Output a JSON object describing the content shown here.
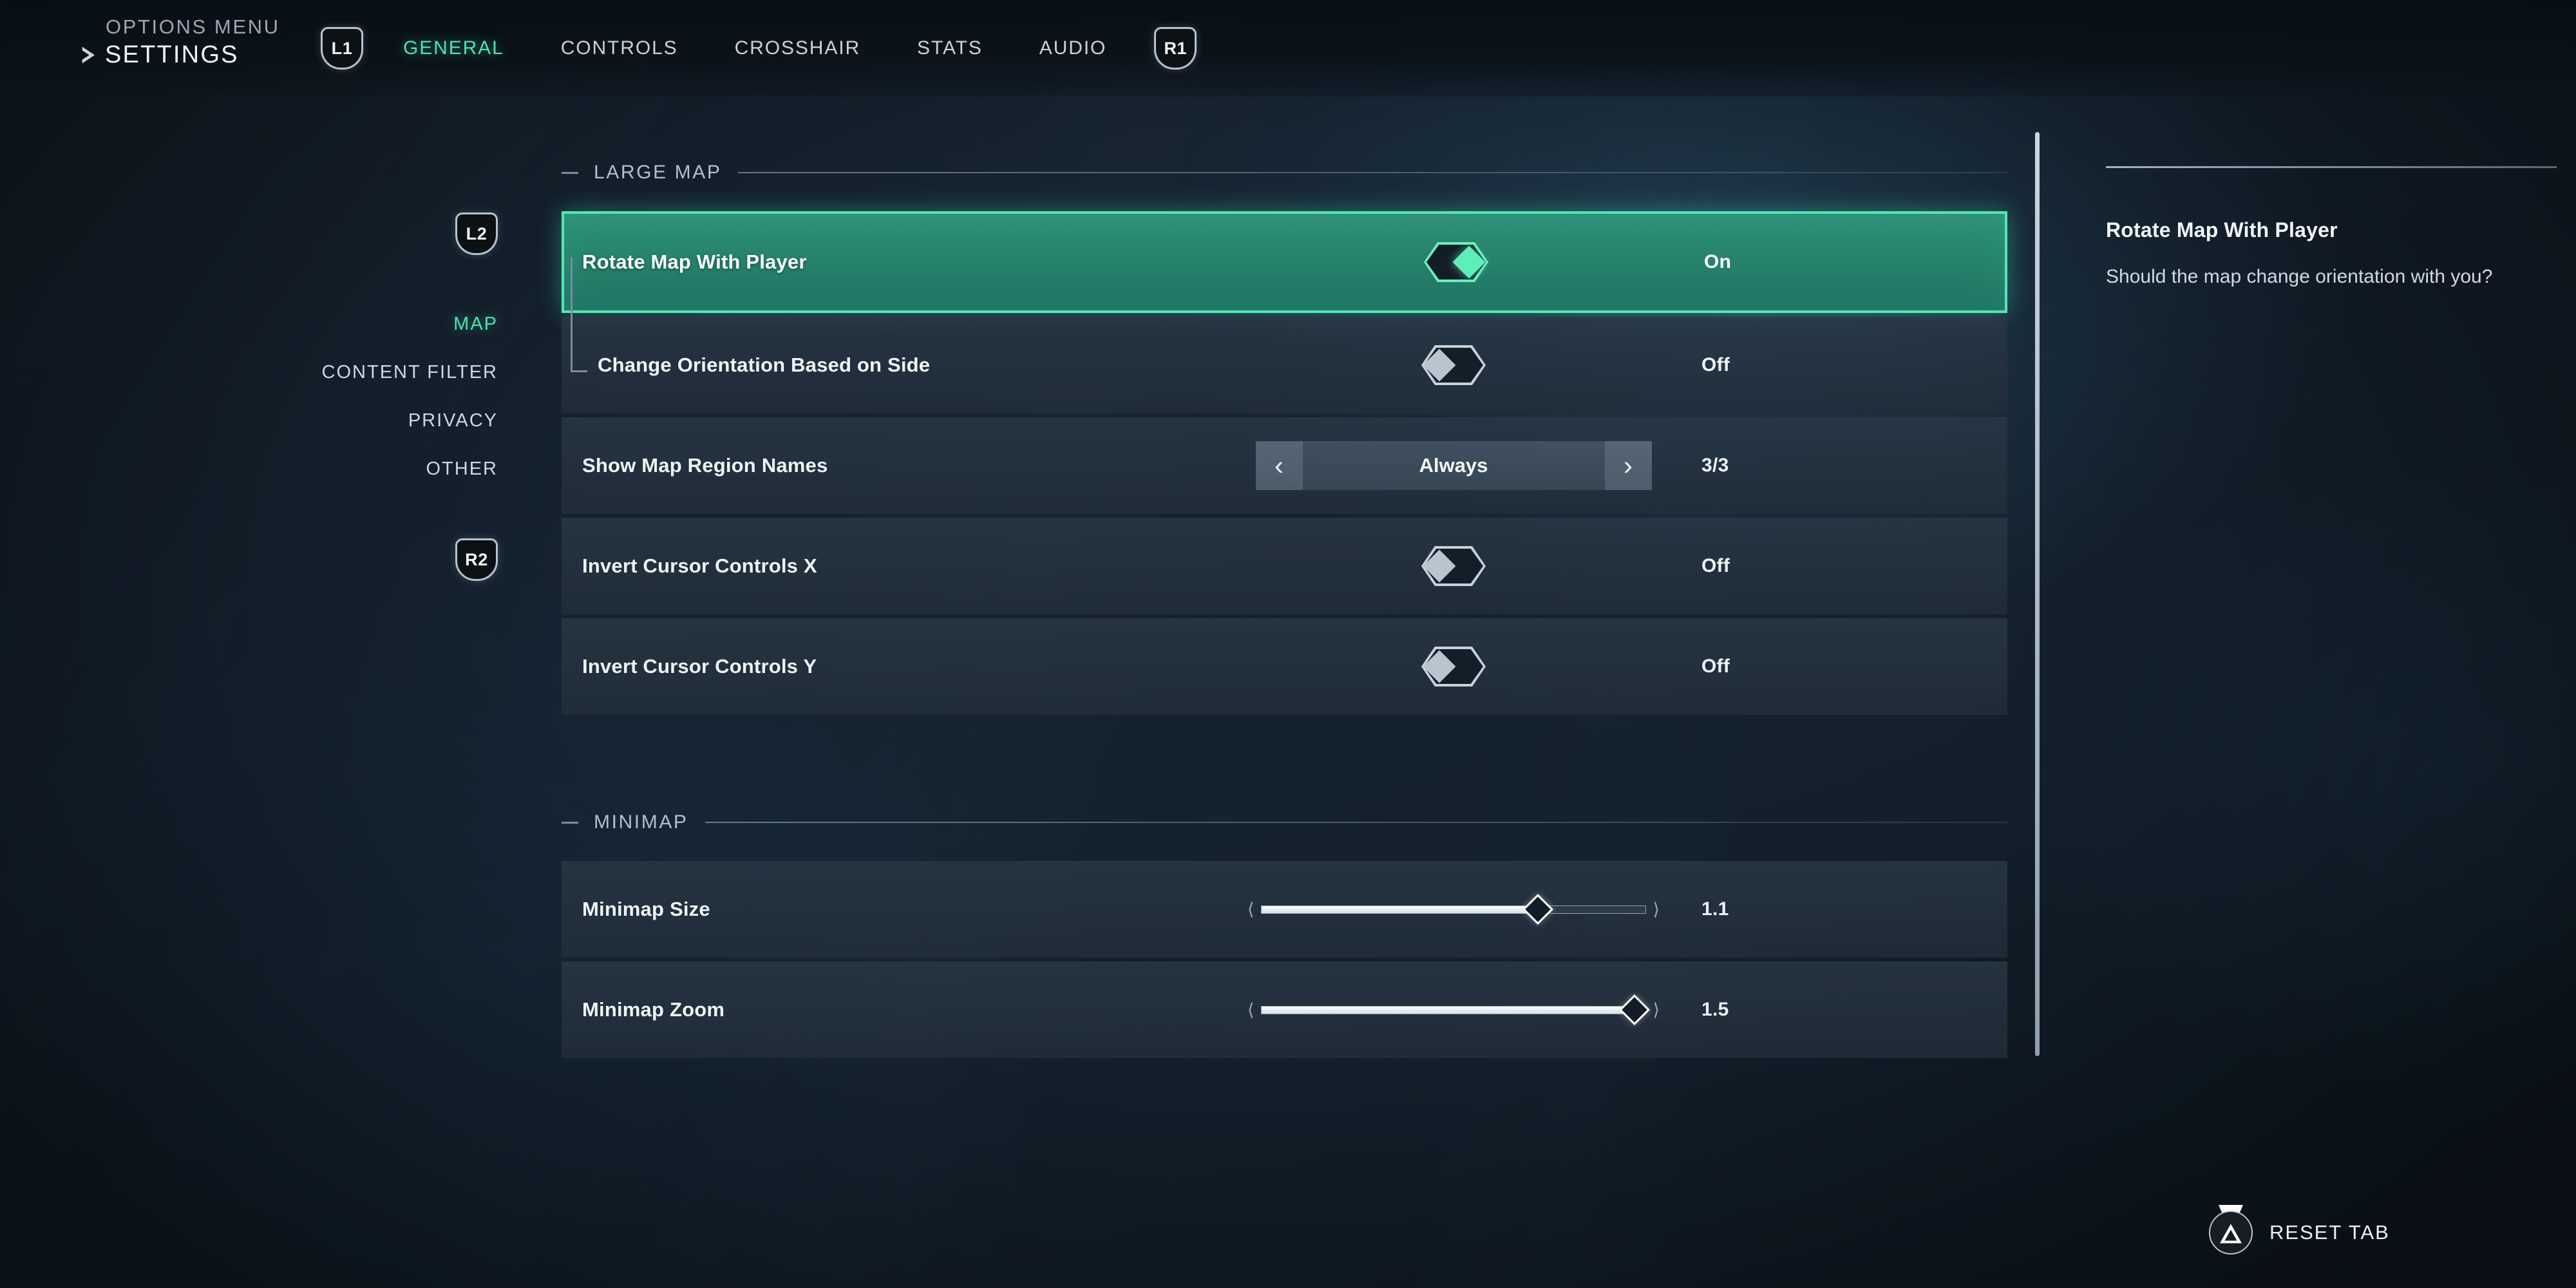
{
  "colors": {
    "accent": "#4fe3b2",
    "selected_row_bg": "#2e8f76",
    "selected_border": "#52e7b6",
    "background": "#16222e",
    "row_bg": "#2a3846",
    "text_primary": "#eef4f8",
    "text_muted": "#b3c0cb"
  },
  "header": {
    "eyebrow": "OPTIONS MENU",
    "title": "SETTINGS",
    "caret_icon": "play-caret-icon",
    "left_bumper": {
      "label": "L1",
      "icon": "bumper-badge-icon"
    },
    "right_bumper": {
      "label": "R1",
      "icon": "bumper-badge-icon"
    },
    "tabs": [
      {
        "label": "GENERAL",
        "active": true
      },
      {
        "label": "CONTROLS",
        "active": false
      },
      {
        "label": "CROSSHAIR",
        "active": false
      },
      {
        "label": "STATS",
        "active": false
      },
      {
        "label": "AUDIO",
        "active": false
      }
    ]
  },
  "sidebar": {
    "top_trigger": {
      "label": "L2",
      "icon": "trigger-badge-icon"
    },
    "bottom_trigger": {
      "label": "R2",
      "icon": "trigger-badge-icon"
    },
    "items": [
      {
        "label": "MAP",
        "active": true
      },
      {
        "label": "CONTENT FILTER",
        "active": false
      },
      {
        "label": "PRIVACY",
        "active": false
      },
      {
        "label": "OTHER",
        "active": false
      }
    ]
  },
  "sections": [
    {
      "title": "LARGE MAP",
      "rows": [
        {
          "label": "Rotate Map With Player",
          "control": "toggle",
          "state": "on",
          "value": "On",
          "selected": true,
          "sub": false
        },
        {
          "label": "Change Orientation Based on Side",
          "control": "toggle",
          "state": "off",
          "value": "Off",
          "selected": false,
          "sub": true
        },
        {
          "label": "Show Map Region Names",
          "control": "stepper",
          "value": "Always",
          "index_label": "3/3",
          "prev_icon": "chevron-left-icon",
          "next_icon": "chevron-right-icon",
          "selected": false,
          "sub": false
        },
        {
          "label": "Invert Cursor Controls X",
          "control": "toggle",
          "state": "off",
          "value": "Off",
          "selected": false,
          "sub": false
        },
        {
          "label": "Invert Cursor Controls Y",
          "control": "toggle",
          "state": "off",
          "value": "Off",
          "selected": false,
          "sub": false
        }
      ]
    },
    {
      "title": "MINIMAP",
      "rows": [
        {
          "label": "Minimap Size",
          "control": "slider",
          "value": "1.1",
          "fill_percent": 72,
          "selected": false,
          "sub": false
        },
        {
          "label": "Minimap Zoom",
          "control": "slider",
          "value": "1.5",
          "fill_percent": 97,
          "selected": false,
          "sub": false
        }
      ]
    }
  ],
  "info_panel": {
    "title": "Rotate Map With Player",
    "description": "Should the map change orientation with you?"
  },
  "footer": {
    "reset_label": "RESET TAB",
    "reset_icon": "playstation-triangle-icon"
  },
  "scrollbar": {
    "name": "settings-scrollbar"
  }
}
